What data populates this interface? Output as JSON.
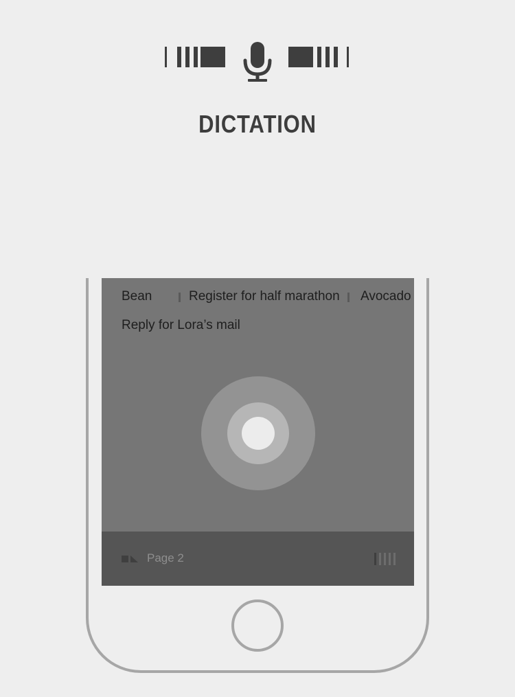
{
  "header": {
    "icon": "microphone-icon",
    "title": "DICTATION",
    "colors": {
      "icon": "#3e3e3e",
      "title": "#3d3d3d"
    }
  },
  "screen": {
    "tags": [
      "Bean",
      "Register for half marathon",
      "Avocado"
    ],
    "reply": "Reply for Lora’s mail",
    "record_button_icon": "record-circle-icon",
    "footer": {
      "icon": "page-icon",
      "page_label": "Page 2",
      "menu_icon": "bars-icon"
    },
    "colors": {
      "screen_bg": "#767676",
      "footer_bg": "#555555",
      "text": "#1e1e1e"
    }
  },
  "device": {
    "home_button_icon": "home-button-icon",
    "frame_color": "#a6a6a6"
  }
}
